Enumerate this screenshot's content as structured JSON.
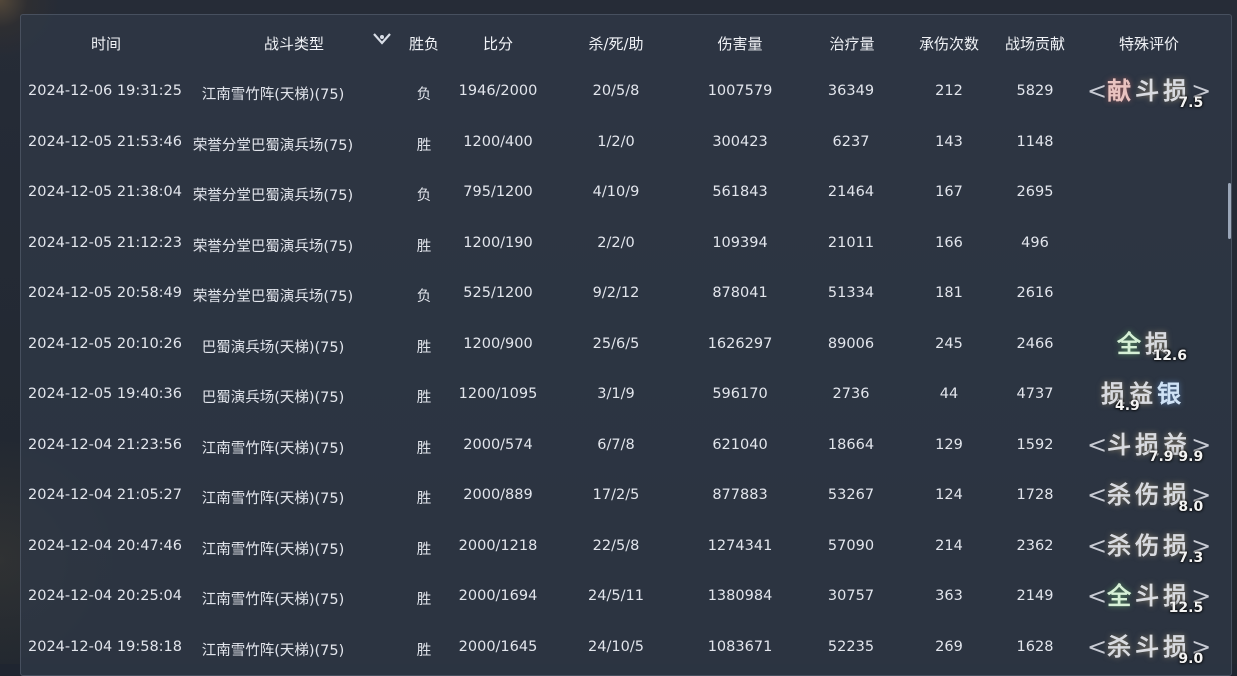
{
  "header": {
    "time": "时间",
    "battle_type": "战斗类型",
    "result": "胜负",
    "score": "比分",
    "kda": "杀/死/助",
    "damage": "伤害量",
    "healing": "治疗量",
    "hits_taken": "承伤次数",
    "contribution": "战场贡献",
    "special": "特殊评价",
    "sort_icon": "chevron-down-icon"
  },
  "rows": [
    {
      "time": "2024-12-06 19:31:25",
      "type": "江南雪竹阵(天梯)(75)",
      "result": "负",
      "score": "1946/2000",
      "kda": "20/5/8",
      "damage": "1007579",
      "healing": "36349",
      "hits": "212",
      "contribution": "5829",
      "badge": {
        "chars": "献斗损",
        "framed": true,
        "score": "7.5"
      }
    },
    {
      "time": "2024-12-05 21:53:46",
      "type": "荣誉分堂巴蜀演兵场(75)",
      "result": "胜",
      "score": "1200/400",
      "kda": "1/2/0",
      "damage": "300423",
      "healing": "6237",
      "hits": "143",
      "contribution": "1148",
      "badge": null
    },
    {
      "time": "2024-12-05 21:38:04",
      "type": "荣誉分堂巴蜀演兵场(75)",
      "result": "负",
      "score": "795/1200",
      "kda": "4/10/9",
      "damage": "561843",
      "healing": "21464",
      "hits": "167",
      "contribution": "2695",
      "badge": null
    },
    {
      "time": "2024-12-05 21:12:23",
      "type": "荣誉分堂巴蜀演兵场(75)",
      "result": "胜",
      "score": "1200/190",
      "kda": "2/2/0",
      "damage": "109394",
      "healing": "21011",
      "hits": "166",
      "contribution": "496",
      "badge": null
    },
    {
      "time": "2024-12-05 20:58:49",
      "type": "荣誉分堂巴蜀演兵场(75)",
      "result": "负",
      "score": "525/1200",
      "kda": "9/2/12",
      "damage": "878041",
      "healing": "51334",
      "hits": "181",
      "contribution": "2616",
      "badge": null
    },
    {
      "time": "2024-12-05 20:10:26",
      "type": "巴蜀演兵场(天梯)(75)",
      "result": "胜",
      "score": "1200/900",
      "kda": "25/6/5",
      "damage": "1626297",
      "healing": "89006",
      "hits": "245",
      "contribution": "2466",
      "badge": {
        "chars": "全损",
        "framed": false,
        "score": "12.6"
      }
    },
    {
      "time": "2024-12-05 19:40:36",
      "type": "巴蜀演兵场(天梯)(75)",
      "result": "胜",
      "score": "1200/1095",
      "kda": "3/1/9",
      "damage": "596170",
      "healing": "2736",
      "hits": "44",
      "contribution": "4737",
      "badge": {
        "chars": "损益银",
        "framed": false,
        "score": "4.9"
      }
    },
    {
      "time": "2024-12-04 21:23:56",
      "type": "江南雪竹阵(天梯)(75)",
      "result": "胜",
      "score": "2000/574",
      "kda": "6/7/8",
      "damage": "621040",
      "healing": "18664",
      "hits": "129",
      "contribution": "1592",
      "badge": {
        "chars": "斗损益",
        "framed": true,
        "score": "7.9 9.9"
      }
    },
    {
      "time": "2024-12-04 21:05:27",
      "type": "江南雪竹阵(天梯)(75)",
      "result": "胜",
      "score": "2000/889",
      "kda": "17/2/5",
      "damage": "877883",
      "healing": "53267",
      "hits": "124",
      "contribution": "1728",
      "badge": {
        "chars": "杀伤损",
        "framed": true,
        "score": "8.0"
      }
    },
    {
      "time": "2024-12-04 20:47:46",
      "type": "江南雪竹阵(天梯)(75)",
      "result": "胜",
      "score": "2000/1218",
      "kda": "22/5/8",
      "damage": "1274341",
      "healing": "57090",
      "hits": "214",
      "contribution": "2362",
      "badge": {
        "chars": "杀伤损",
        "framed": true,
        "score": "7.3"
      }
    },
    {
      "time": "2024-12-04 20:25:04",
      "type": "江南雪竹阵(天梯)(75)",
      "result": "胜",
      "score": "2000/1694",
      "kda": "24/5/11",
      "damage": "1380984",
      "healing": "30757",
      "hits": "363",
      "contribution": "2149",
      "badge": {
        "chars": "全斗损",
        "framed": true,
        "score": "12.5"
      }
    },
    {
      "time": "2024-12-04 19:58:18",
      "type": "江南雪竹阵(天梯)(75)",
      "result": "胜",
      "score": "2000/1645",
      "kda": "24/10/5",
      "damage": "1083671",
      "healing": "52235",
      "hits": "269",
      "contribution": "1628",
      "badge": {
        "chars": "杀斗损",
        "framed": true,
        "score": "9.0"
      }
    }
  ],
  "brackets": {
    "left": "<",
    "right": ">"
  }
}
